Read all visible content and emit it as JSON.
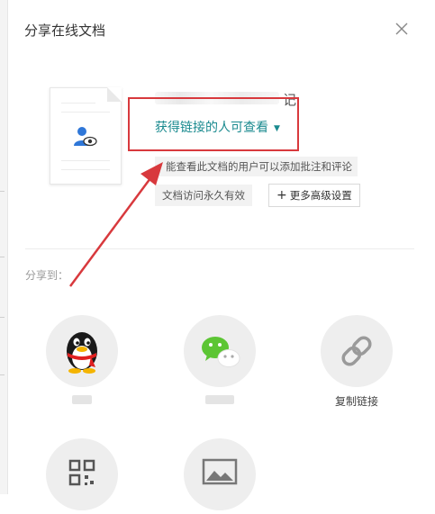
{
  "dialog": {
    "title": "分享在线文档",
    "close_icon": "close-icon"
  },
  "document": {
    "name_visible_tail": "记",
    "icon": "shared-user-doc-icon"
  },
  "permission": {
    "selected": "获得链接的人可查看",
    "dropdown_icon": "caret-down-icon",
    "description": "能查看此文档的用户可以添加批注和评论",
    "expiry": "文档访问永久有效",
    "advanced_label": "更多高级设置",
    "advanced_icon": "plus-icon"
  },
  "share": {
    "label": "分享到：",
    "targets": [
      {
        "icon": "qq-penguin-icon",
        "label": ""
      },
      {
        "icon": "wechat-icon",
        "label": ""
      },
      {
        "icon": "link-icon",
        "label": "复制链接"
      },
      {
        "icon": "qrcode-icon",
        "label": ""
      },
      {
        "icon": "image-icon",
        "label": ""
      }
    ]
  },
  "colors": {
    "accent_teal": "#1a8a8f",
    "highlight_red": "#d8393d",
    "circle_bg": "#eeeeee"
  }
}
